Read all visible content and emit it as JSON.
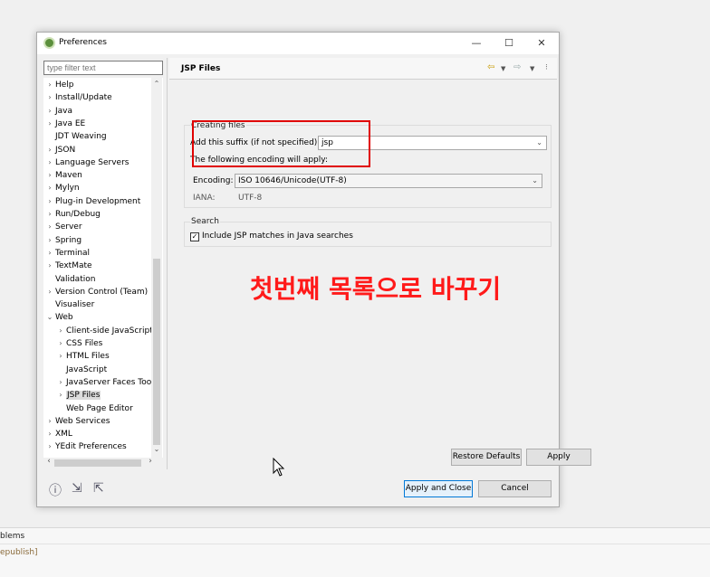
{
  "window": {
    "title": "Preferences",
    "minimize": "—",
    "maximize": "☐",
    "close": "✕"
  },
  "filter": {
    "placeholder": "type filter text"
  },
  "tree": {
    "items": [
      {
        "label": "Help",
        "twisty": "›"
      },
      {
        "label": "Install/Update",
        "twisty": "›"
      },
      {
        "label": "Java",
        "twisty": "›"
      },
      {
        "label": "Java EE",
        "twisty": "›"
      },
      {
        "label": "JDT Weaving",
        "twisty": ""
      },
      {
        "label": "JSON",
        "twisty": "›"
      },
      {
        "label": "Language Servers",
        "twisty": "›"
      },
      {
        "label": "Maven",
        "twisty": "›"
      },
      {
        "label": "Mylyn",
        "twisty": "›"
      },
      {
        "label": "Plug-in Development",
        "twisty": "›"
      },
      {
        "label": "Run/Debug",
        "twisty": "›"
      },
      {
        "label": "Server",
        "twisty": "›"
      },
      {
        "label": "Spring",
        "twisty": "›"
      },
      {
        "label": "Terminal",
        "twisty": "›"
      },
      {
        "label": "TextMate",
        "twisty": "›"
      },
      {
        "label": "Validation",
        "twisty": ""
      },
      {
        "label": "Version Control (Team)",
        "twisty": "›"
      },
      {
        "label": "Visualiser",
        "twisty": ""
      },
      {
        "label": "Web",
        "twisty": "⌄"
      },
      {
        "label": "Client-side JavaScript",
        "twisty": "›",
        "child": true
      },
      {
        "label": "CSS Files",
        "twisty": "›",
        "child": true
      },
      {
        "label": "HTML Files",
        "twisty": "›",
        "child": true
      },
      {
        "label": "JavaScript",
        "twisty": "",
        "child": true
      },
      {
        "label": "JavaServer Faces Too",
        "twisty": "›",
        "child": true
      },
      {
        "label": "JSP Files",
        "twisty": "›",
        "child": true,
        "selected": true
      },
      {
        "label": "Web Page Editor",
        "twisty": "",
        "child": true
      },
      {
        "label": "Web Services",
        "twisty": "›"
      },
      {
        "label": "XML",
        "twisty": "›"
      },
      {
        "label": "YEdit Preferences",
        "twisty": "›"
      }
    ]
  },
  "panel": {
    "title": "JSP Files",
    "creating": {
      "label": "Creating files",
      "suffix_label": "Add this suffix (if not specified):",
      "suffix_value": "jsp",
      "encoding_note": "The following encoding will apply:",
      "encoding_label": "Encoding:",
      "encoding_value": "ISO 10646/Unicode(UTF-8)",
      "iana_label": "IANA:",
      "iana_value": "UTF-8"
    },
    "search": {
      "label": "Search",
      "checkbox_label": "Include JSP matches in Java searches",
      "checked": true
    },
    "restore_defaults": "Restore Defaults",
    "apply": "Apply"
  },
  "annotation": "첫번째 목록으로 바꾸기",
  "footer": {
    "apply_close": "Apply and Close",
    "cancel": "Cancel"
  },
  "background": {
    "problems_tab": "blems",
    "message": "epublish]"
  },
  "colors": {
    "annotation": "#ff1a1a",
    "highlight_box": "#e00000",
    "default_button_border": "#0078d7"
  }
}
